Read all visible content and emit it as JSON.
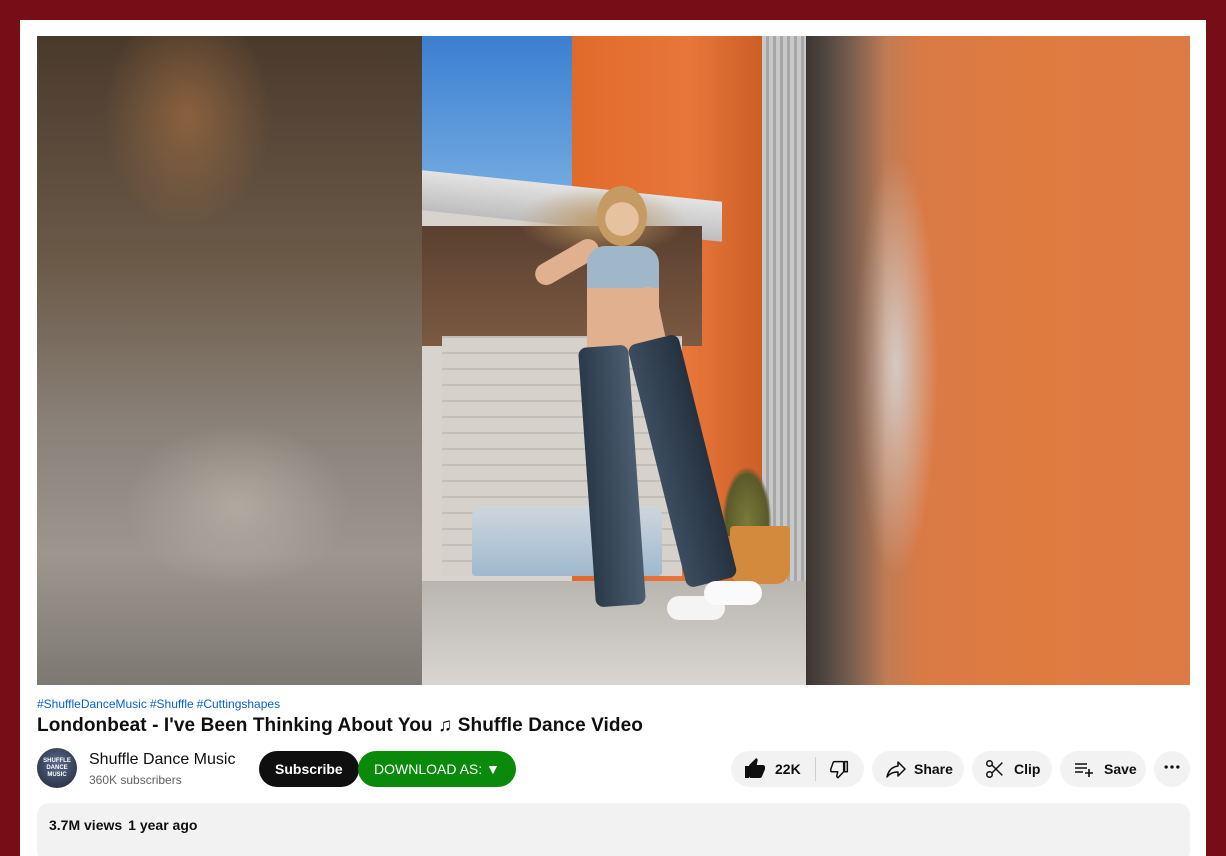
{
  "video": {
    "hashtags": [
      "#ShuffleDanceMusic",
      "#Shuffle",
      "#Cuttingshapes"
    ],
    "title": "Londonbeat - I've Been Thinking About You ♫ Shuffle Dance Video"
  },
  "channel": {
    "name": "Shuffle Dance Music",
    "subscribers": "360K subscribers",
    "avatar_text": "SHUFFLE DANCE MUSIC"
  },
  "actions": {
    "subscribe_label": "Subscribe",
    "download_label": "DOWNLOAD AS: ▼",
    "like_count": "22K",
    "share_label": "Share",
    "clip_label": "Clip",
    "save_label": "Save"
  },
  "description": {
    "views": "3.7M views",
    "published": "1 year ago"
  },
  "colors": {
    "frame": "#760d17",
    "link": "#065fd4",
    "download_button": "#0a8a0a",
    "subscribe_button": "#0f0f0f"
  }
}
